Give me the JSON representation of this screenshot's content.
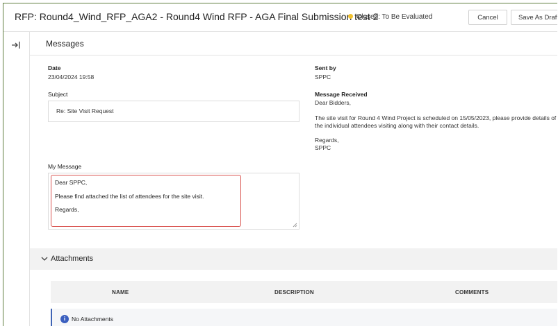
{
  "header": {
    "title": "RFP: Round4_Wind_RFP_AGA2 - Round4 Wind RFP - AGA Final Submission test 2",
    "status": "Closed: To Be Evaluated",
    "status_color": "#f2c230",
    "cancel_label": "Cancel",
    "save_draft_label": "Save As Draft"
  },
  "section": {
    "title": "Messages"
  },
  "message": {
    "date_label": "Date",
    "date_value": "23/04/2024 19:58",
    "sent_by_label": "Sent by",
    "sent_by_value": "SPPC",
    "subject_label": "Subject",
    "subject_value": "Re: Site Visit Request",
    "received_label": "Message Received",
    "received_lines": [
      "Dear Bidders,",
      "The site visit for Round 4 Wind Project is scheduled on 15/05/2023, please provide details of",
      "the individual attendees visiting along with their contact details.",
      "Regards,",
      "SPPC"
    ],
    "my_message_label": "My Message",
    "my_message_lines": [
      "Dear SPPC,",
      "Please find attached the list of attendees for the site visit.",
      "Regards,"
    ]
  },
  "attachments": {
    "title": "Attachments",
    "columns": [
      "NAME",
      "DESCRIPTION",
      "COMMENTS"
    ],
    "empty_text": "No Attachments"
  },
  "icons": {
    "sidebar_toggle": "collapse-right-icon",
    "attachments_toggle": "chevron-down-icon",
    "empty_info": "info-icon"
  }
}
